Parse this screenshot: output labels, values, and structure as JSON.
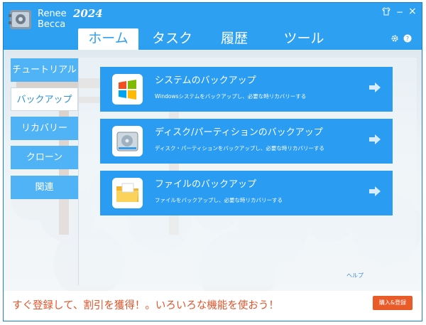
{
  "app": {
    "brand_line1": "Renee",
    "brand_line2": "Becca",
    "brand_year": "2024"
  },
  "window_controls": {
    "tshirt_icon": "tshirt-icon",
    "minimize": "−",
    "close": "×"
  },
  "header_icons": [
    "gear-icon",
    "help-icon"
  ],
  "tabs": [
    {
      "label": "ホーム",
      "active": true
    },
    {
      "label": "タスク",
      "active": false
    },
    {
      "label": "履歴",
      "active": false
    },
    {
      "label": "ツール",
      "active": false
    }
  ],
  "sidebar": {
    "items": [
      {
        "label": "チュートリアル",
        "active": false
      },
      {
        "label": "バックアップ",
        "active": true
      },
      {
        "label": "リカバリー",
        "active": false
      },
      {
        "label": "クローン",
        "active": false
      },
      {
        "label": "関連",
        "active": false
      }
    ]
  },
  "cards": [
    {
      "title": "システムのバックアップ",
      "desc": "Windowsシステムをバックアップし、必要な時リカバリーする",
      "icon": "windows-logo-icon"
    },
    {
      "title": "ディスク/パーティションのバックアップ",
      "desc": "ディスク・パーティションをバックアップし、必要な時リカバリーする",
      "icon": "hard-disk-icon"
    },
    {
      "title": "ファイルのバックアップ",
      "desc": "ファイルをバックアップし、必要な時リカバリーする",
      "icon": "folder-icon"
    }
  ],
  "help_label": "ヘルプ",
  "footer": {
    "promo": "すぐ登録して、割引を獲得！。いろいろな機能を使おう！",
    "buy_label": "購入&登録"
  },
  "colors": {
    "header_blue": "#2ea0f2",
    "card_blue": "#2a9cf2",
    "sidebar_blue": "#4fb3f5",
    "promo_orange": "#e5532a",
    "buy_button": "#ea5b2a"
  }
}
